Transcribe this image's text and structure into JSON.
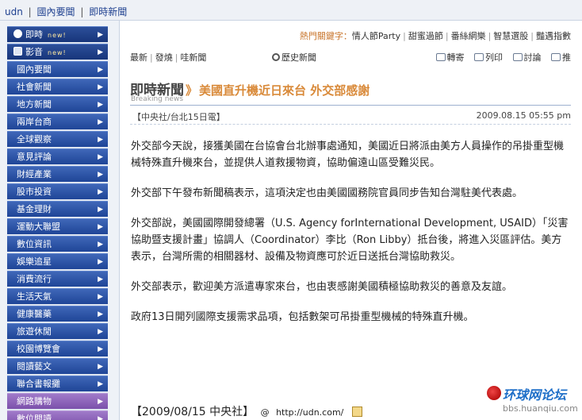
{
  "breadcrumb": [
    "udn",
    "國內要聞",
    "即時新聞"
  ],
  "sidebar": {
    "items": [
      {
        "label": "即時",
        "new": "new!",
        "style": "top",
        "icon": "clock-icon"
      },
      {
        "label": "影音",
        "new": "new!",
        "style": "top",
        "icon": "video-icon"
      },
      {
        "label": "國內要聞",
        "style": "blue"
      },
      {
        "label": "社會新聞",
        "style": "blue"
      },
      {
        "label": "地方新聞",
        "style": "blue"
      },
      {
        "label": "兩岸台商",
        "style": "blue"
      },
      {
        "label": "全球觀察",
        "style": "blue"
      },
      {
        "label": "意見評論",
        "style": "blue"
      },
      {
        "label": "財經產業",
        "style": "blue"
      },
      {
        "label": "股市投資",
        "style": "blue"
      },
      {
        "label": "基金理財",
        "style": "blue"
      },
      {
        "label": "運動大聯盟",
        "style": "blue"
      },
      {
        "label": "數位資訊",
        "style": "blue"
      },
      {
        "label": "娛樂追星",
        "style": "blue"
      },
      {
        "label": "消費流行",
        "style": "blue"
      },
      {
        "label": "生活天氣",
        "style": "blue"
      },
      {
        "label": "健康醫藥",
        "style": "blue"
      },
      {
        "label": "旅遊休閒",
        "style": "blue"
      },
      {
        "label": "校園博覽會",
        "style": "blue"
      },
      {
        "label": "閱讀藝文",
        "style": "blue"
      },
      {
        "label": "聯合書報攤",
        "style": "blue"
      },
      {
        "label": "網路購物",
        "style": "purple"
      },
      {
        "label": "數位閱讀",
        "style": "purple"
      }
    ]
  },
  "hot": {
    "label": "熱門關鍵字：",
    "keywords": [
      "情人節Party",
      "甜蜜過節",
      "番絲網樂",
      "智慧選股",
      "豔遇指數"
    ]
  },
  "tabs": [
    "最新",
    "發燒",
    "哇新聞"
  ],
  "history_label": "歷史新聞",
  "tools": [
    "轉寄",
    "列印",
    "討論",
    "推"
  ],
  "section": {
    "title": "即時新聞",
    "arrow": "》",
    "subtitle": "Breaking news"
  },
  "headline": "美國直升機近日來台 外交部感謝",
  "source": "【中央社/台北15日電】",
  "timestamp": "2009.08.15 05:55 pm",
  "paragraphs": [
    "外交部今天說，接獲美國在台協會台北辦事處通知，美國近日將派由美方人員操作的吊掛重型機械特殊直升機來台，並提供人道救援物資，協助偏遠山區受難災民。",
    "外交部下午發布新聞稿表示，這項決定也由美國國務院官員同步告知台灣駐美代表處。",
    "外交部說，美國國際開發總署（U.S. Agency forInternational Development, USAID）「災害協助暨支援計畫」協調人（Coordinator）李比（Ron Libby）抵台後，將進入災區評估。美方表示，台灣所需的相關器材、設備及物資應可於近日送抵台灣協助救災。",
    "外交部表示，歡迎美方派遣專家來台，也由衷感謝美國積極協助救災的善意及友誼。",
    "政府13日開列國際支援需求品項，包括數架可吊掛重型機械的特殊直升機。"
  ],
  "footer": {
    "dateline": "【2009/08/15 中央社】",
    "copyright": "@",
    "url": "http://udn.com/"
  },
  "watermark": {
    "title": "环球网论坛",
    "url": "bbs.huanqiu.com"
  },
  "colors": {
    "accent": "#d98a3a",
    "sidebar": "#1f4597",
    "link": "#1d3f8f"
  }
}
